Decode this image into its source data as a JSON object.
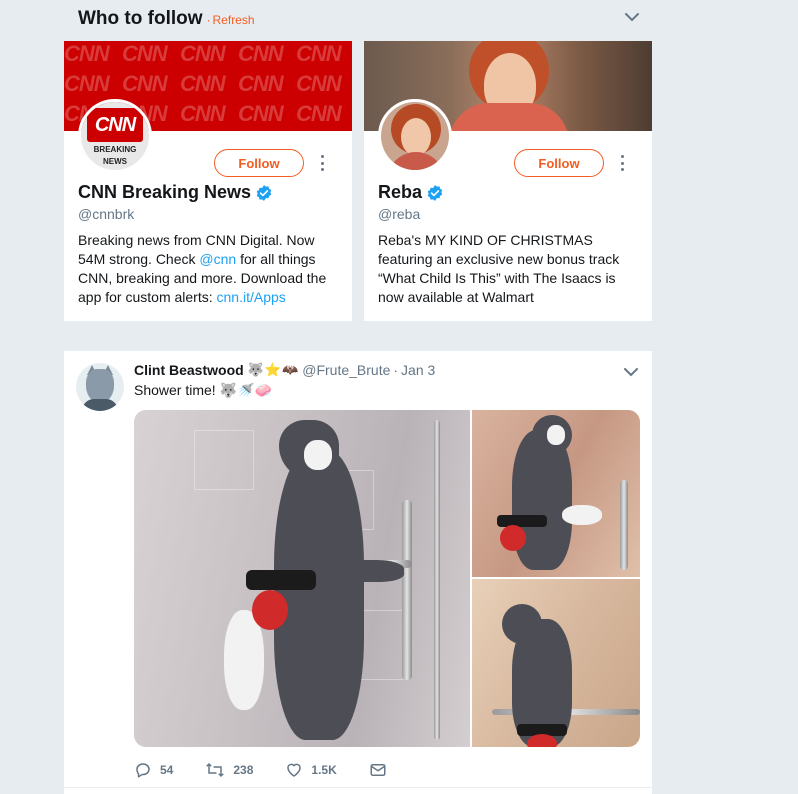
{
  "who_to_follow": {
    "title": "Who to follow",
    "separator": "·",
    "refresh_label": "Refresh",
    "accent_color": "#f45d22",
    "cards": [
      {
        "name": "CNN Breaking News",
        "handle": "@cnnbrk",
        "verified": true,
        "follow_label": "Follow",
        "avatar_text_line1": "CNN",
        "avatar_text_line2": "BREAKING",
        "avatar_text_line3": "NEWS",
        "banner_text": "CNN",
        "bio_part1": "Breaking news from CNN Digital. Now 54M strong. Check ",
        "bio_link1": "@cnn",
        "bio_part2": " for all things CNN, breaking and more. Download the app for custom alerts: ",
        "bio_link2": "cnn.it/Apps"
      },
      {
        "name": "Reba",
        "handle": "@reba",
        "verified": true,
        "follow_label": "Follow",
        "bio": "Reba's MY KIND OF CHRISTMAS featuring an exclusive new bonus track “What Child Is This” with The Isaacs is now available at Walmart"
      }
    ]
  },
  "tweet": {
    "author_name": "Clint Beastwood",
    "author_emoji": "🐺⭐🦇",
    "handle": "@Frute_Brute",
    "dot": "·",
    "date": "Jan 3",
    "text": "Shower time! 🐺🚿🧼",
    "actions": {
      "replies": "54",
      "retweets": "238",
      "likes": "1.5K"
    },
    "media_count": 3
  }
}
